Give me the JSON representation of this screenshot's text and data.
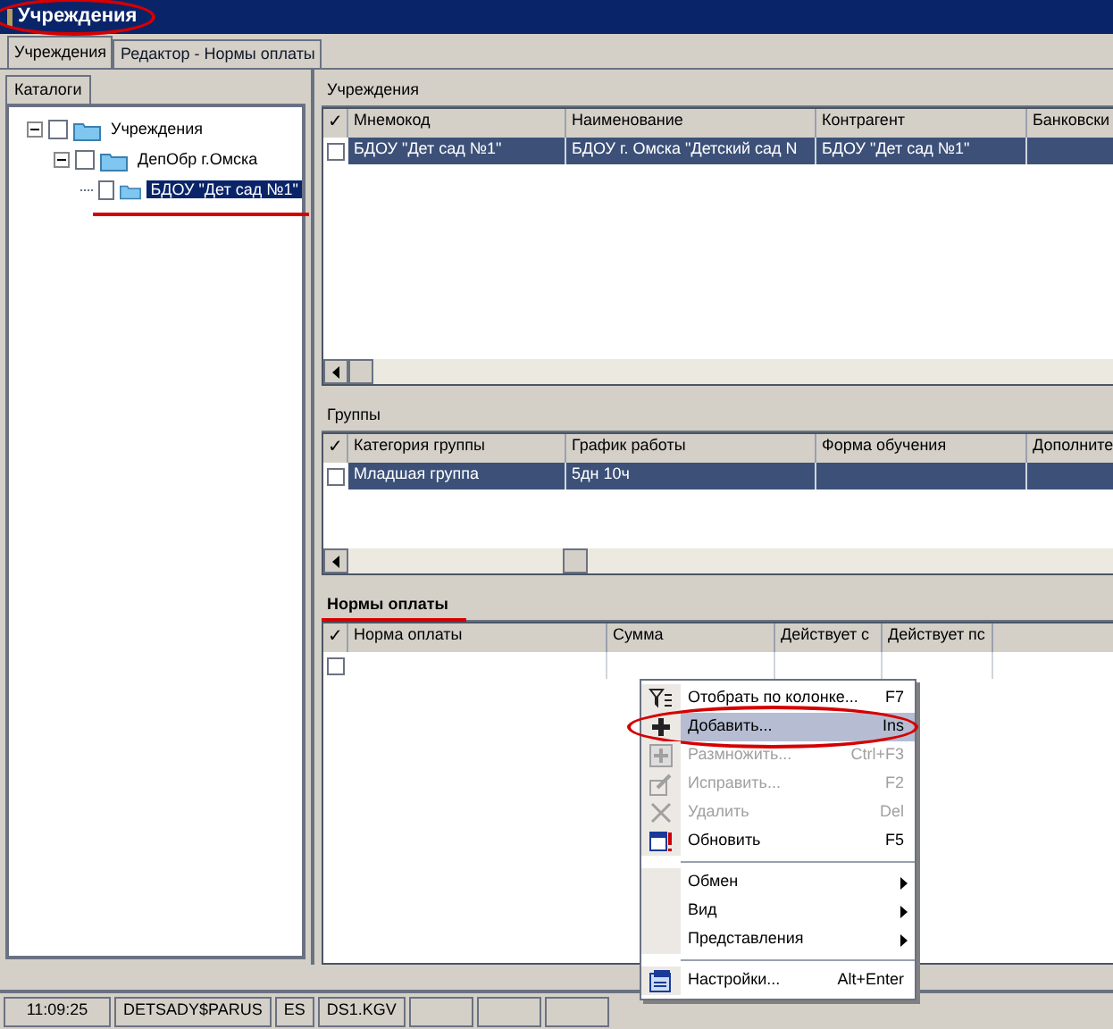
{
  "window": {
    "title": "Учреждения",
    "annotated": true
  },
  "tabs": [
    {
      "label": "Учреждения",
      "selected": true
    },
    {
      "label": "Редактор - Нормы оплаты",
      "selected": false
    }
  ],
  "catalog_tab": {
    "label": "Каталоги"
  },
  "tree": [
    {
      "label": "Учреждения",
      "checked": false,
      "selected": false,
      "expanded": true,
      "children": [
        {
          "label": "ДепОбр г.Омска",
          "checked": false,
          "selected": false,
          "expanded": true,
          "children": [
            {
              "label": "БДОУ \"Дет сад №1\"",
              "checked": false,
              "selected": true,
              "annotated": true
            }
          ]
        }
      ]
    }
  ],
  "sections": [
    {
      "title": "Учреждения",
      "bold": false,
      "check_header": "✓",
      "columns": [
        "Мнемокод",
        "Наименование",
        "Контрагент",
        "Банковски"
      ],
      "rows": [
        {
          "cells": [
            "БДОУ \"Дет сад №1\"",
            "БДОУ г. Омска \"Детский сад N",
            "БДОУ \"Дет сад №1\"",
            ""
          ],
          "selected": true,
          "checked": false
        }
      ]
    },
    {
      "title": "Группы",
      "bold": false,
      "check_header": "✓",
      "columns": [
        "Категория группы",
        "График работы",
        "Форма обучения",
        "Дополните"
      ],
      "rows": [
        {
          "cells": [
            "Младшая группа",
            "5дн 10ч",
            "",
            ""
          ],
          "selected": true,
          "checked": false
        }
      ]
    },
    {
      "title": "Нормы оплаты",
      "bold": true,
      "annotated": true,
      "check_header": "✓",
      "columns": [
        "Норма оплаты",
        "Сумма",
        "Действует с",
        "Действует пс"
      ],
      "rows": [
        {
          "cells": [
            "",
            "",
            "",
            ""
          ],
          "selected": false,
          "checked": false
        }
      ]
    }
  ],
  "context_menu": [
    {
      "kind": "item",
      "label": "Отобрать по колонке...",
      "shortcut": "F7",
      "disabled": false,
      "selected": false
    },
    {
      "kind": "item",
      "label": "Добавить...",
      "shortcut": "Ins",
      "disabled": false,
      "selected": true,
      "annotated": true
    },
    {
      "kind": "item",
      "label": "Размножить...",
      "shortcut": "Ctrl+F3",
      "disabled": true,
      "selected": false
    },
    {
      "kind": "item",
      "label": "Исправить...",
      "shortcut": "F2",
      "disabled": true,
      "selected": false
    },
    {
      "kind": "item",
      "label": "Удалить",
      "shortcut": "Del",
      "disabled": true,
      "selected": false
    },
    {
      "kind": "item",
      "label": "Обновить",
      "shortcut": "F5",
      "disabled": false,
      "selected": false
    },
    {
      "kind": "separator"
    },
    {
      "kind": "submenu",
      "label": "Обмен",
      "disabled": false,
      "selected": false
    },
    {
      "kind": "submenu",
      "label": "Вид",
      "disabled": false,
      "selected": false
    },
    {
      "kind": "submenu",
      "label": "Представления",
      "disabled": false,
      "selected": false
    },
    {
      "kind": "separator"
    },
    {
      "kind": "item",
      "label": "Настройки...",
      "shortcut": "Alt+Enter",
      "disabled": false,
      "selected": false
    }
  ],
  "status_bar": [
    "11:09:25",
    "DETSADY$PARUS",
    "ES",
    "DS1.KGV"
  ]
}
